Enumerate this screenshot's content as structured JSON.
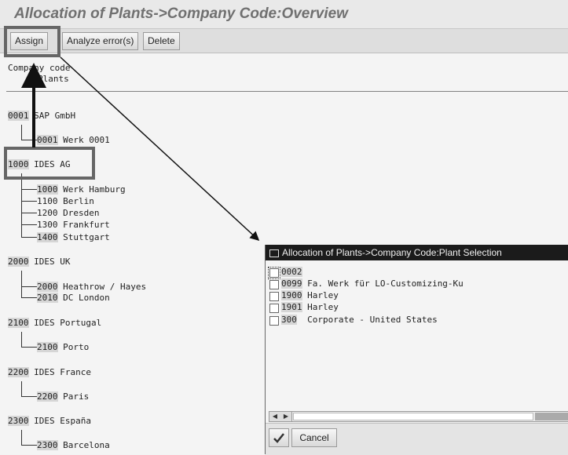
{
  "window": {
    "title": "Allocation of Plants->Company Code:Overview"
  },
  "toolbar": {
    "assign": "Assign",
    "analyze": "Analyze error(s)",
    "delete": "Delete"
  },
  "header": {
    "col1": "Company code",
    "col2": "Plants"
  },
  "companies": [
    {
      "code": "0001",
      "name": "SAP GmbH",
      "plants": [
        {
          "code": "0001",
          "name": "Werk 0001"
        }
      ]
    },
    {
      "code": "1000",
      "name": "IDES AG",
      "plants": [
        {
          "code": "1000",
          "name": "Werk Hamburg"
        },
        {
          "code": "1100",
          "name": "Berlin"
        },
        {
          "code": "1200",
          "name": "Dresden"
        },
        {
          "code": "1300",
          "name": "Frankfurt"
        },
        {
          "code": "1400",
          "name": "Stuttgart"
        }
      ]
    },
    {
      "code": "2000",
      "name": "IDES UK",
      "plants": [
        {
          "code": "2000",
          "name": "Heathrow / Hayes"
        },
        {
          "code": "2010",
          "name": "DC London"
        }
      ]
    },
    {
      "code": "2100",
      "name": "IDES Portugal",
      "plants": [
        {
          "code": "2100",
          "name": "Porto"
        }
      ]
    },
    {
      "code": "2200",
      "name": "IDES France",
      "plants": [
        {
          "code": "2200",
          "name": "Paris"
        }
      ]
    },
    {
      "code": "2300",
      "name": "IDES España",
      "plants": [
        {
          "code": "2300",
          "name": "Barcelona"
        }
      ]
    }
  ],
  "popup": {
    "title": "Allocation of Plants->Company Code:Plant Selection",
    "items": [
      {
        "code": "0002",
        "name": ""
      },
      {
        "code": "0099",
        "name": "Fa. Werk für LO-Customizing-Ku"
      },
      {
        "code": "1900",
        "name": "Harley"
      },
      {
        "code": "1901",
        "name": "Harley"
      },
      {
        "code": "300",
        "name": "Corporate - United States"
      }
    ],
    "cancel": "Cancel"
  }
}
